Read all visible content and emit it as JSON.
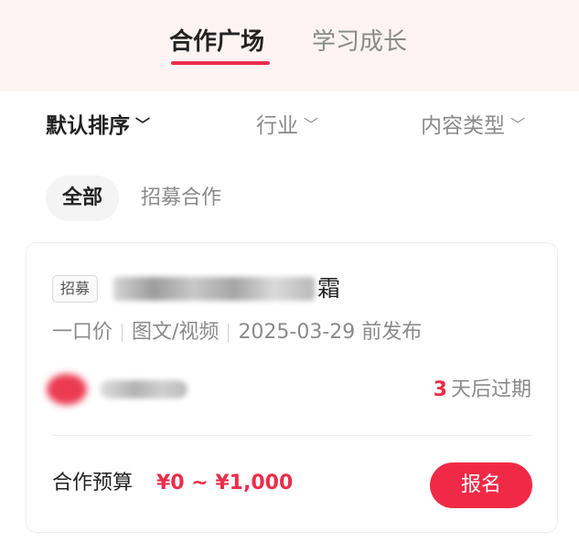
{
  "top_tabs": [
    {
      "label": "合作广场",
      "active": true
    },
    {
      "label": "学习成长",
      "active": false
    }
  ],
  "filters": {
    "sort": "默认排序",
    "industry": "行业",
    "content_type": "内容类型",
    "chevron_icon": "chevron-down-icon"
  },
  "chips": [
    {
      "label": "全部",
      "active": true
    },
    {
      "label": "招募合作",
      "active": false
    }
  ],
  "card": {
    "badge": "招募",
    "title_visible_tail": "霜",
    "meta": [
      "一口价",
      "图文/视频",
      "2025-03-29 前发布"
    ],
    "expire_days": "3",
    "expire_text": "天后过期",
    "budget_label": "合作预算",
    "budget_value": "¥0 ~ ¥1,000",
    "apply_label": "报名"
  },
  "colors": {
    "accent": "#ea2e4a",
    "button": "#f02a46",
    "header_bg": "#fcf3f2"
  }
}
